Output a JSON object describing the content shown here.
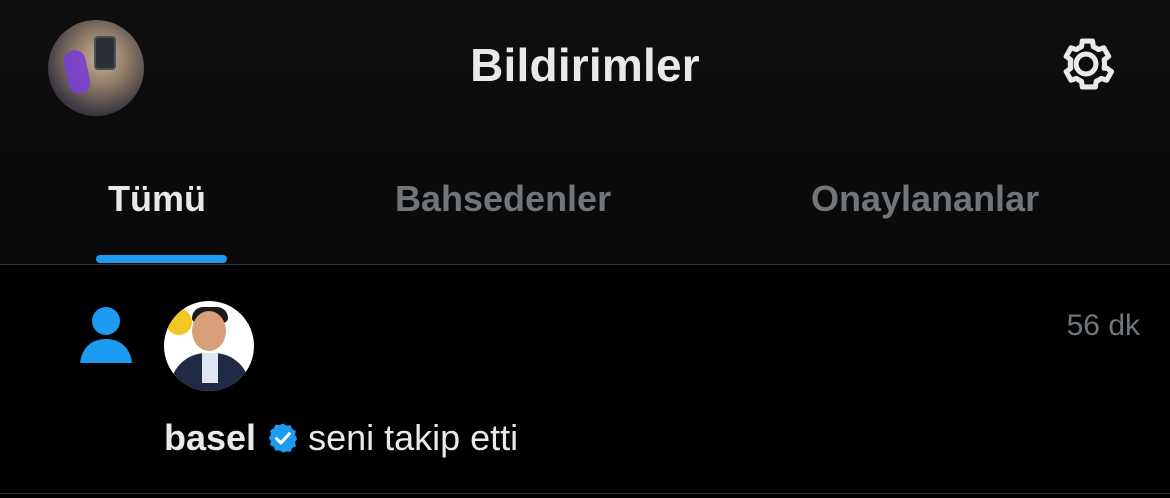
{
  "header": {
    "title": "Bildirimler",
    "profile_avatar_alt": "",
    "settings_icon": "gear-icon"
  },
  "tabs": [
    {
      "label": "Tümü",
      "active": true
    },
    {
      "label": "Bahsedenler",
      "active": false
    },
    {
      "label": "Onaylananlar",
      "active": false
    }
  ],
  "colors": {
    "accent": "#1d9bf0",
    "muted": "#71767b",
    "text": "#e7e9ea",
    "background": "#000000"
  },
  "notification": {
    "type_icon": "person-icon",
    "time": "56 dk",
    "username": "basel",
    "verified_icon": "verified-badge-icon",
    "action": "seni takip etti"
  }
}
